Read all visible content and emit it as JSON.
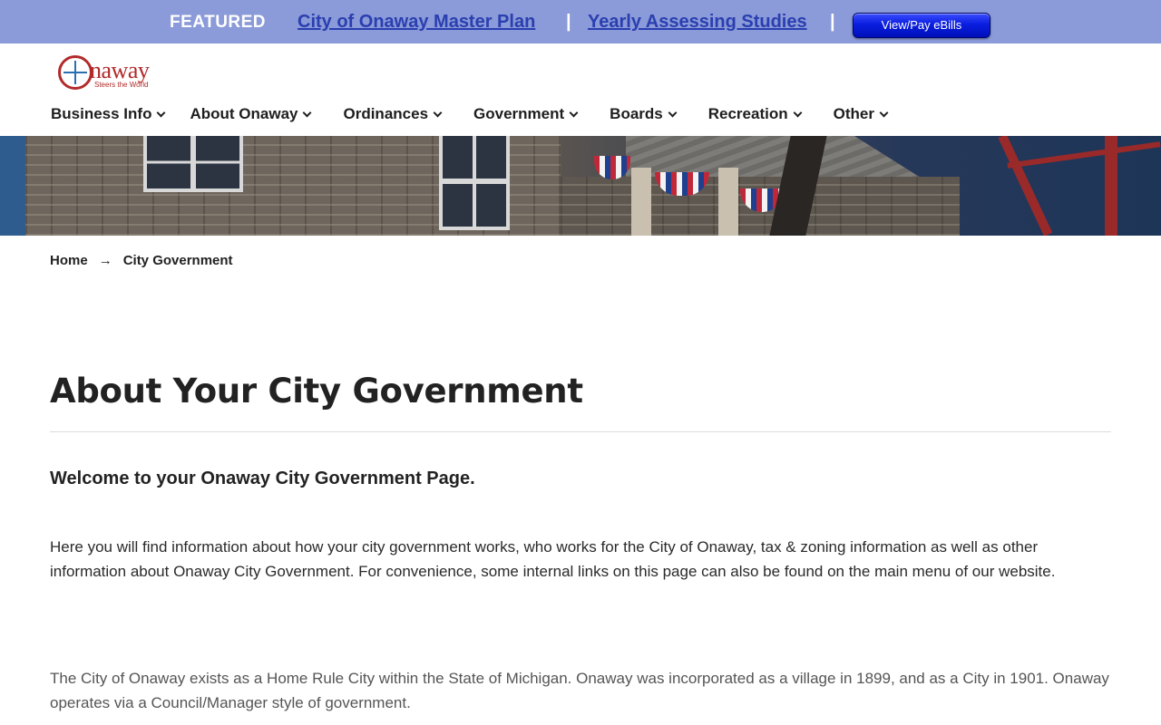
{
  "featured": {
    "label": "FEATURED",
    "links": [
      "City of Onaway Master Plan",
      "Yearly Assessing Studies"
    ],
    "separator": "|",
    "ebills_button": "View/Pay eBills"
  },
  "logo": {
    "text": "naway",
    "tagline": "Steers the World"
  },
  "nav": {
    "items": [
      {
        "label": "Business Info"
      },
      {
        "label": "About Onaway"
      },
      {
        "label": "Ordinances"
      },
      {
        "label": "Government"
      },
      {
        "label": "Boards"
      },
      {
        "label": "Recreation"
      },
      {
        "label": "Other"
      }
    ]
  },
  "breadcrumb": {
    "home": "Home",
    "arrow": "→",
    "current": "City Government"
  },
  "main": {
    "title": "About Your City Government",
    "welcome": "Welcome to your Onaway City Government Page.",
    "intro": "Here you will find information about how your city government works, who works for the City of Onaway, tax & zoning information as well as other information about Onaway City Government. For convenience, some internal links on this page can also be found on the main menu of our website.",
    "body": "The City of Onaway exists as a Home Rule City within the State of Michigan. Onaway was incorporated as a village in 1899, and as a City in 1901. Onaway operates via a Council/Manager style of government."
  },
  "colors": {
    "featured_bar": "#8b9ad8",
    "featured_link": "#2a3fb0",
    "ebills_button": "#0a1ee0",
    "logo_red": "#b22a2a"
  }
}
